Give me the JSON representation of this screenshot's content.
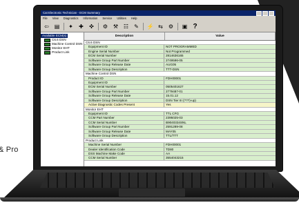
{
  "side_text": "& Pro",
  "app": {
    "title": "Cat Electronic Technician - ECM Summary",
    "menu": [
      "File",
      "View",
      "Diagnostics",
      "Information",
      "Service",
      "Utilities",
      "Help"
    ],
    "toolbar_help": "?"
  },
  "tree": {
    "root": "Available ECM(s)",
    "items": [
      "C6.6 DSN",
      "Machine Control DSN",
      "Monitor EHT",
      "Product Link"
    ]
  },
  "grid": {
    "headers": {
      "description": "Description",
      "value": "Value"
    },
    "rows": [
      {
        "type": "section",
        "d": "C6.6 DSN",
        "v": ""
      },
      {
        "type": "g",
        "d": "Equipment ID",
        "v": "NOT PROGRAMMED"
      },
      {
        "type": "g",
        "d": "Engine Serial Number",
        "v": "Not Programmed"
      },
      {
        "type": "g",
        "d": "ECM Serial Number",
        "v": "2814636165"
      },
      {
        "type": "g",
        "d": "Software Group Part Number",
        "v": "2749596-05"
      },
      {
        "type": "g",
        "d": "Software Group Release Date",
        "v": "AUG05"
      },
      {
        "type": "g",
        "d": "Software Group Description",
        "v": "TTT-DSN"
      },
      {
        "type": "section",
        "d": "Machine Control DSN",
        "v": ""
      },
      {
        "type": "g",
        "d": "Product ID",
        "v": "FDH00001"
      },
      {
        "type": "g",
        "d": "Equipment ID",
        "v": ""
      },
      {
        "type": "g",
        "d": "ECM Serial Number",
        "v": "0505401627"
      },
      {
        "type": "g",
        "d": "Software Group Part Number",
        "v": "2779487-01"
      },
      {
        "type": "g",
        "d": "Software Group Release Date",
        "v": "15.01.12"
      },
      {
        "type": "g",
        "d": "Software Group Description",
        "v": "DSN Tier III (???)-up)"
      },
      {
        "type": "y",
        "d": "Active Diagnostic Codes Present",
        "v": "Yes"
      },
      {
        "type": "section",
        "d": "Monitor EHT",
        "v": ""
      },
      {
        "type": "g",
        "d": "Equipment ID",
        "v": "TTL CFG"
      },
      {
        "type": "g",
        "d": "CCM Part Number",
        "v": "2395025-03"
      },
      {
        "type": "g",
        "d": "CCM Serial Number",
        "v": "B9040334SNL"
      },
      {
        "type": "g",
        "d": "Software Group Part Number",
        "v": "2591289-08"
      },
      {
        "type": "g",
        "d": "Software Group Release Date",
        "v": "MAY05"
      },
      {
        "type": "g",
        "d": "Software Group Description",
        "v": "TTL/TTT"
      },
      {
        "type": "section",
        "d": "Product Link",
        "v": ""
      },
      {
        "type": "g",
        "d": "Machine Serial Number",
        "v": "FDH00001"
      },
      {
        "type": "g",
        "d": "Dealer Identification Code",
        "v": "TD80"
      },
      {
        "type": "g",
        "d": "DSS Machine Make Code",
        "v": "AA"
      },
      {
        "type": "g",
        "d": "CCM Serial Number",
        "v": "3554043215"
      }
    ]
  }
}
